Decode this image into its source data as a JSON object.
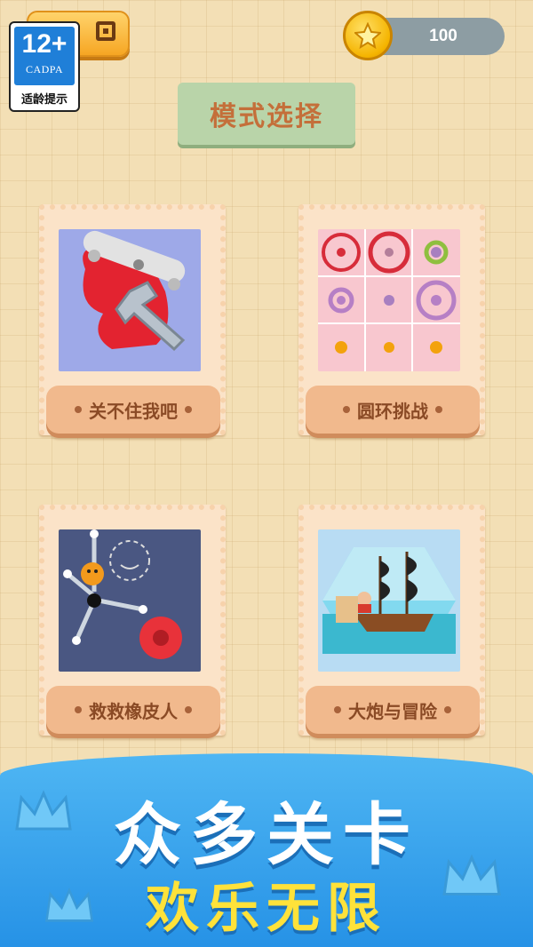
{
  "header": {
    "age_rating": {
      "number": "12+",
      "org": "CADPA",
      "tip": "适龄提示"
    },
    "coins": "100"
  },
  "title": "模式选择",
  "modes": [
    {
      "label": "关不住我吧"
    },
    {
      "label": "圆环挑战"
    },
    {
      "label": "救救橡皮人"
    },
    {
      "label": "大炮与冒险"
    }
  ],
  "banner": {
    "line1": "众多关卡",
    "line2": "欢乐无限"
  },
  "colors": {
    "background": "#f3dfb5",
    "banner": "#2692e6",
    "banner_accent": "#ffe23a",
    "title_box": "#b9d4a9"
  }
}
